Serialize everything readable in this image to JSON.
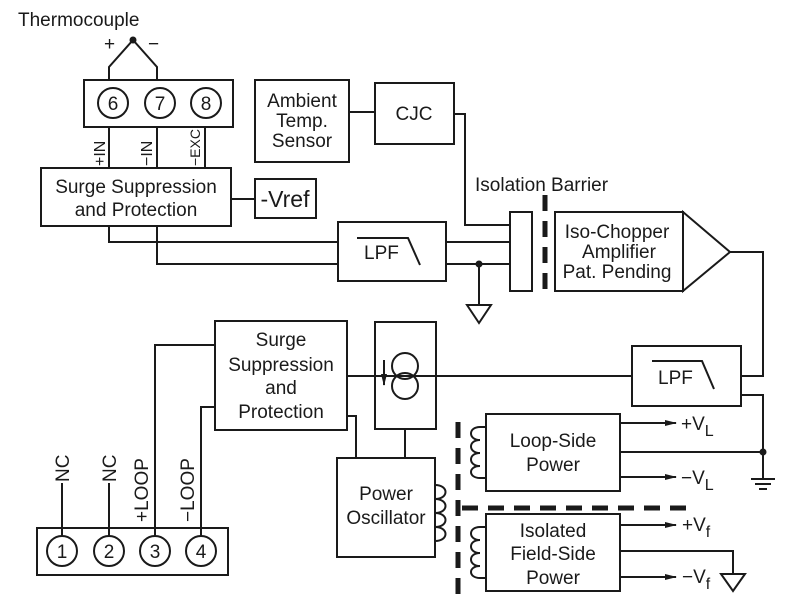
{
  "thermocouple": {
    "label": "Thermocouple",
    "plus": "+",
    "minus": "−"
  },
  "top_terminals": [
    "6",
    "7",
    "8"
  ],
  "top_wire_labels": [
    "+IN",
    "−IN",
    "−EXC"
  ],
  "surge_top": {
    "line1": "Surge Suppression",
    "line2": "and Protection"
  },
  "vref": "-Vref",
  "ambient": {
    "line1": "Ambient",
    "line2": "Temp.",
    "line3": "Sensor"
  },
  "cjc": "CJC",
  "isolation_barrier": "Isolation Barrier",
  "lpf_label": "LPF",
  "iso_chopper": {
    "line1": "Iso-Chopper",
    "line2": "Amplifier",
    "line3": "Pat. Pending"
  },
  "surge_bottom": {
    "line1": "Surge",
    "line2": "Suppression",
    "line3": "and",
    "line4": "Protection"
  },
  "power_oscillator": {
    "line1": "Power",
    "line2": "Oscillator"
  },
  "loop_side_power": {
    "line1": "Loop-Side",
    "line2": "Power"
  },
  "field_side_power": {
    "line1": "Isolated",
    "line2": "Field-Side",
    "line3": "Power"
  },
  "outputs": {
    "plus_vl": {
      "main": "+V",
      "sub": "L"
    },
    "minus_vl": {
      "main": "−V",
      "sub": "L"
    },
    "plus_vf": {
      "main": "+V",
      "sub": "f"
    },
    "minus_vf": {
      "main": "−V",
      "sub": "f"
    }
  },
  "bottom_terminals": [
    "1",
    "2",
    "3",
    "4"
  ],
  "bottom_wire_labels": [
    "NC",
    "NC",
    "+LOOP",
    "−LOOP"
  ]
}
